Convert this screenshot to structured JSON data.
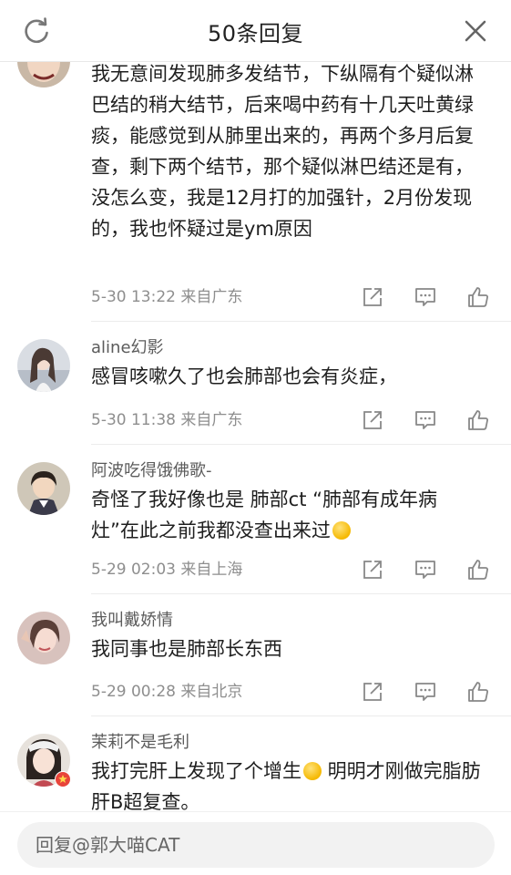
{
  "header": {
    "title": "50条回复"
  },
  "comments": [
    {
      "username": "",
      "text": "我无意间发现肺多发结节，下纵隔有个疑似淋巴结的稍大结节，后来喝中药有十几天吐黄绿痰，能感觉到从肺里出来的，再两个多月后复查，剩下两个结节，那个疑似淋巴结还是有，没怎么变，我是12月打的加强针，2月份发现的，我也怀疑过是ym原因",
      "time": "5-30 13:22",
      "location": "来自广东"
    },
    {
      "username": "aline幻影",
      "text": "感冒咳嗽久了也会肺部也会有炎症，",
      "time": "5-30 11:38",
      "location": "来自广东"
    },
    {
      "username": "阿波吃得饿佛歌-",
      "text": "奇怪了我好像也是  肺部ct “肺部有成年病灶”在此之前我都没查出来过",
      "time": "5-29 02:03",
      "location": "来自上海"
    },
    {
      "username": "我叫戴娇情",
      "text": "我同事也是肺部长东西",
      "time": "5-29 00:28",
      "location": "来自北京"
    },
    {
      "username": "茉莉不是毛利",
      "text": "我打完肝上发现了个增生",
      "text_after_emoji": " 明明才刚做完脂肪肝B超复查。"
    }
  ],
  "reply_box": {
    "placeholder": "回复@郭大喵CAT"
  },
  "icons": {
    "refresh": "refresh-icon",
    "close": "close-icon",
    "share": "share-icon",
    "reply": "comment-icon",
    "like": "thumbs-up-icon"
  }
}
